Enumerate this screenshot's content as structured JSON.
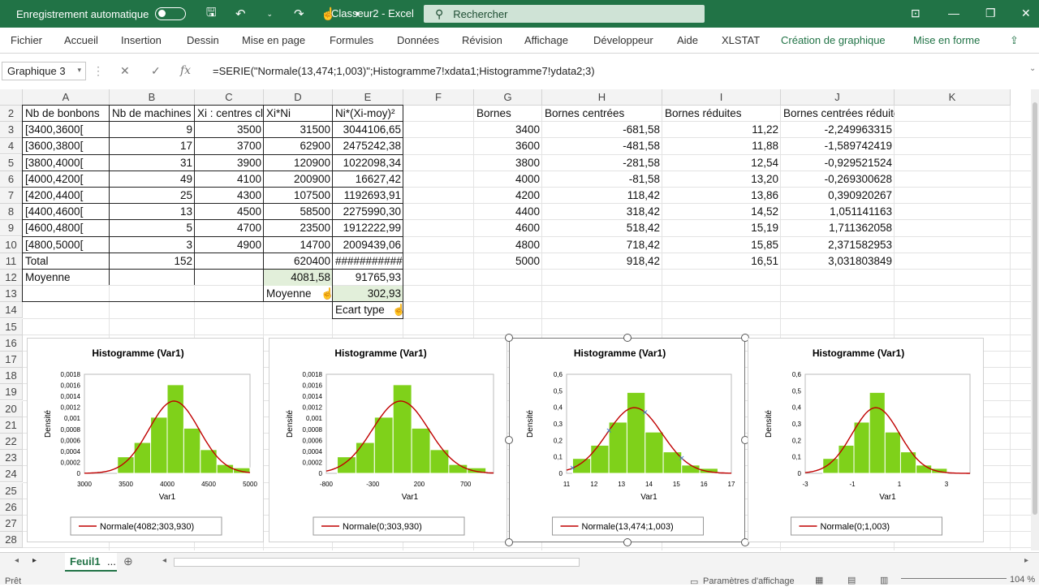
{
  "titlebar": {
    "autosave_label": "Enregistrement automatique",
    "title": "Classeur2  -  Excel",
    "search_placeholder": "Rechercher"
  },
  "menu": [
    "Fichier",
    "Accueil",
    "Insertion",
    "Dessin",
    "Mise en page",
    "Formules",
    "Données",
    "Révision",
    "Affichage",
    "Développeur",
    "Aide",
    "XLSTAT",
    "Création de graphique",
    "Mise en forme"
  ],
  "formula": {
    "namebox": "Graphique 3",
    "text": "=SERIE(\"Normale(13,474;1,003)\";Histogramme7!xdata1;Histogramme7!ydata2;3)"
  },
  "columns": [
    "A",
    "B",
    "C",
    "D",
    "E",
    "F",
    "G",
    "H",
    "I",
    "J",
    "K"
  ],
  "rows": [
    "2",
    "3",
    "4",
    "5",
    "6",
    "7",
    "8",
    "9",
    "10",
    "11",
    "12",
    "13",
    "14",
    "15",
    "16",
    "17",
    "18",
    "19",
    "20",
    "21",
    "22",
    "23",
    "24",
    "25",
    "26",
    "27",
    "28"
  ],
  "table_left": {
    "headers": [
      "Nb de bonbons",
      "Nb de machines",
      "Xi : centres cl",
      "Xi*Ni",
      "Ni*(Xi-moy)²"
    ],
    "rows": [
      [
        "[3400,3600[",
        "9",
        "3500",
        "31500",
        "3044106,65"
      ],
      [
        "[3600,3800[",
        "17",
        "3700",
        "62900",
        "2475242,38"
      ],
      [
        "[3800,4000[",
        "31",
        "3900",
        "120900",
        "1022098,34"
      ],
      [
        "[4000,4200[",
        "49",
        "4100",
        "200900",
        "16627,42"
      ],
      [
        "[4200,4400[",
        "25",
        "4300",
        "107500",
        "1192693,91"
      ],
      [
        "[4400,4600[",
        "13",
        "4500",
        "58500",
        "2275990,30"
      ],
      [
        "[4600,4800[",
        "5",
        "4700",
        "23500",
        "1912222,99"
      ],
      [
        "[4800,5000[",
        "3",
        "4900",
        "14700",
        "2009439,06"
      ]
    ],
    "total_label": "Total",
    "total_b": "152",
    "total_d": "620400",
    "total_e": "###########",
    "moyenne_label": "Moyenne",
    "moyenne_d": "4081,58",
    "moyenne_e": "91765,93",
    "moyenne2_label": "Moyenne",
    "moyenne2_e": "302,93",
    "ecart_label": "Ecart type"
  },
  "table_right": {
    "headers": [
      "Bornes",
      "Bornes centrées",
      "Bornes réduites",
      "Bornes centrées réduites"
    ],
    "rows": [
      [
        "3400",
        "-681,58",
        "11,22",
        "-2,249963315"
      ],
      [
        "3600",
        "-481,58",
        "11,88",
        "-1,589742419"
      ],
      [
        "3800",
        "-281,58",
        "12,54",
        "-0,929521524"
      ],
      [
        "4000",
        "-81,58",
        "13,20",
        "-0,269300628"
      ],
      [
        "4200",
        "118,42",
        "13,86",
        "0,390920267"
      ],
      [
        "4400",
        "318,42",
        "14,52",
        "1,051141163"
      ],
      [
        "4600",
        "518,42",
        "15,19",
        "1,711362058"
      ],
      [
        "4800",
        "718,42",
        "15,85",
        "2,371582953"
      ],
      [
        "5000",
        "918,42",
        "16,51",
        "3,031803849"
      ]
    ]
  },
  "colors": {
    "excel_green": "#217346",
    "bar": "#7fd11a",
    "curve": "#c00000",
    "selected_handle": "#555555"
  },
  "chart_data": [
    {
      "type": "bar",
      "title": "Histogramme  (Var1)",
      "xlabel": "Var1",
      "ylabel": "Densité",
      "legend": "Normale(4082;303,930)",
      "xlim": [
        3000,
        5000
      ],
      "ylim": [
        0,
        0.0018
      ],
      "xticks": [
        "3000",
        "3500",
        "4000",
        "4500",
        "5000"
      ],
      "yticks": [
        "0",
        "0,0002",
        "0,0004",
        "0,0006",
        "0,0008",
        "0,001",
        "0,0012",
        "0,0014",
        "0,0016",
        "0,0018"
      ],
      "bins": [
        3400,
        3600,
        3800,
        4000,
        4200,
        4400,
        4600,
        4800,
        5000
      ],
      "values": [
        0.0003,
        0.00056,
        0.00102,
        0.00161,
        0.00082,
        0.00043,
        0.00016,
        0.0001
      ],
      "curve": {
        "mean": 4082,
        "sd": 303.93
      }
    },
    {
      "type": "bar",
      "title": "Histogramme  (Var1)",
      "xlabel": "Var1",
      "ylabel": "Densité",
      "legend": "Normale(0;303,930)",
      "xlim": [
        -800,
        1000
      ],
      "ylim": [
        0,
        0.0018
      ],
      "xticks": [
        "-800",
        "-300",
        "200",
        "700"
      ],
      "yticks": [
        "0",
        "0,0002",
        "0,0004",
        "0,0006",
        "0,0008",
        "0,001",
        "0,0012",
        "0,0014",
        "0,0016",
        "0,0018"
      ],
      "bins": [
        -681.58,
        -481.58,
        -281.58,
        -81.58,
        118.42,
        318.42,
        518.42,
        718.42,
        918.42
      ],
      "values": [
        0.0003,
        0.00056,
        0.00102,
        0.00161,
        0.00082,
        0.00043,
        0.00016,
        0.0001
      ],
      "curve": {
        "mean": 0,
        "sd": 303.93
      }
    },
    {
      "type": "bar",
      "title": "Histogramme  (Var1)",
      "xlabel": "Var1",
      "ylabel": "Densité",
      "legend": "Normale(13,474;1,003)",
      "xlim": [
        11,
        17
      ],
      "ylim": [
        0,
        0.6
      ],
      "xticks": [
        "11",
        "12",
        "13",
        "14",
        "15",
        "16",
        "17"
      ],
      "yticks": [
        "0",
        "0,1",
        "0,2",
        "0,3",
        "0,4",
        "0,5",
        "0,6"
      ],
      "bins": [
        11.22,
        11.88,
        12.54,
        13.2,
        13.86,
        14.52,
        15.19,
        15.85,
        16.51
      ],
      "values": [
        0.09,
        0.17,
        0.31,
        0.49,
        0.25,
        0.13,
        0.05,
        0.03
      ],
      "curve": {
        "mean": 13.474,
        "sd": 1.003
      },
      "selected": true
    },
    {
      "type": "bar",
      "title": "Histogramme  (Var1)",
      "xlabel": "Var1",
      "ylabel": "Densité",
      "legend": "Normale(0;1,003)",
      "xlim": [
        -3,
        4
      ],
      "ylim": [
        0,
        0.6
      ],
      "xticks": [
        "-3",
        "-1",
        "1",
        "3"
      ],
      "yticks": [
        "0",
        "0,1",
        "0,2",
        "0,3",
        "0,4",
        "0,5",
        "0,6"
      ],
      "bins": [
        -2.25,
        -1.59,
        -0.93,
        -0.27,
        0.39,
        1.05,
        1.71,
        2.37,
        3.03
      ],
      "values": [
        0.09,
        0.17,
        0.31,
        0.49,
        0.25,
        0.13,
        0.05,
        0.03
      ],
      "curve": {
        "mean": 0,
        "sd": 1.003
      }
    }
  ],
  "sheet": {
    "tab": "Feuil1",
    "more": "..."
  },
  "status": {
    "left": "Prêt",
    "right": "Paramètres d'affichage",
    "zoom": "104 %"
  }
}
